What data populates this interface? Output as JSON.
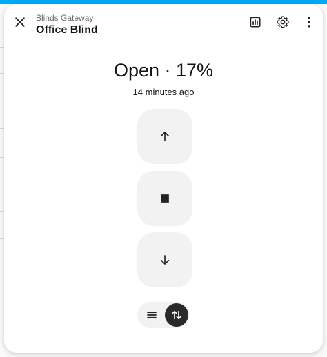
{
  "dialog": {
    "subtitle": "Blinds Gateway",
    "title": "Office Blind"
  },
  "header_icons": {
    "close": "close-icon",
    "history": "chart-box-icon",
    "settings": "gear-icon",
    "more": "dots-vertical-icon"
  },
  "cover": {
    "state_text": "Open · 17%",
    "last_changed": "14 minutes ago",
    "position_percent": 17,
    "controls": {
      "open": "arrow-up-icon",
      "stop": "stop-icon",
      "close": "arrow-down-icon"
    }
  },
  "view_modes": {
    "items": [
      "list-icon",
      "swap-vertical-icon"
    ],
    "active": "swap-vertical-icon"
  },
  "colors": {
    "accent": "#03a9f4",
    "control_bg": "#f2f2f2",
    "active_toggle": "#2a2a2a",
    "text": "#141414"
  }
}
